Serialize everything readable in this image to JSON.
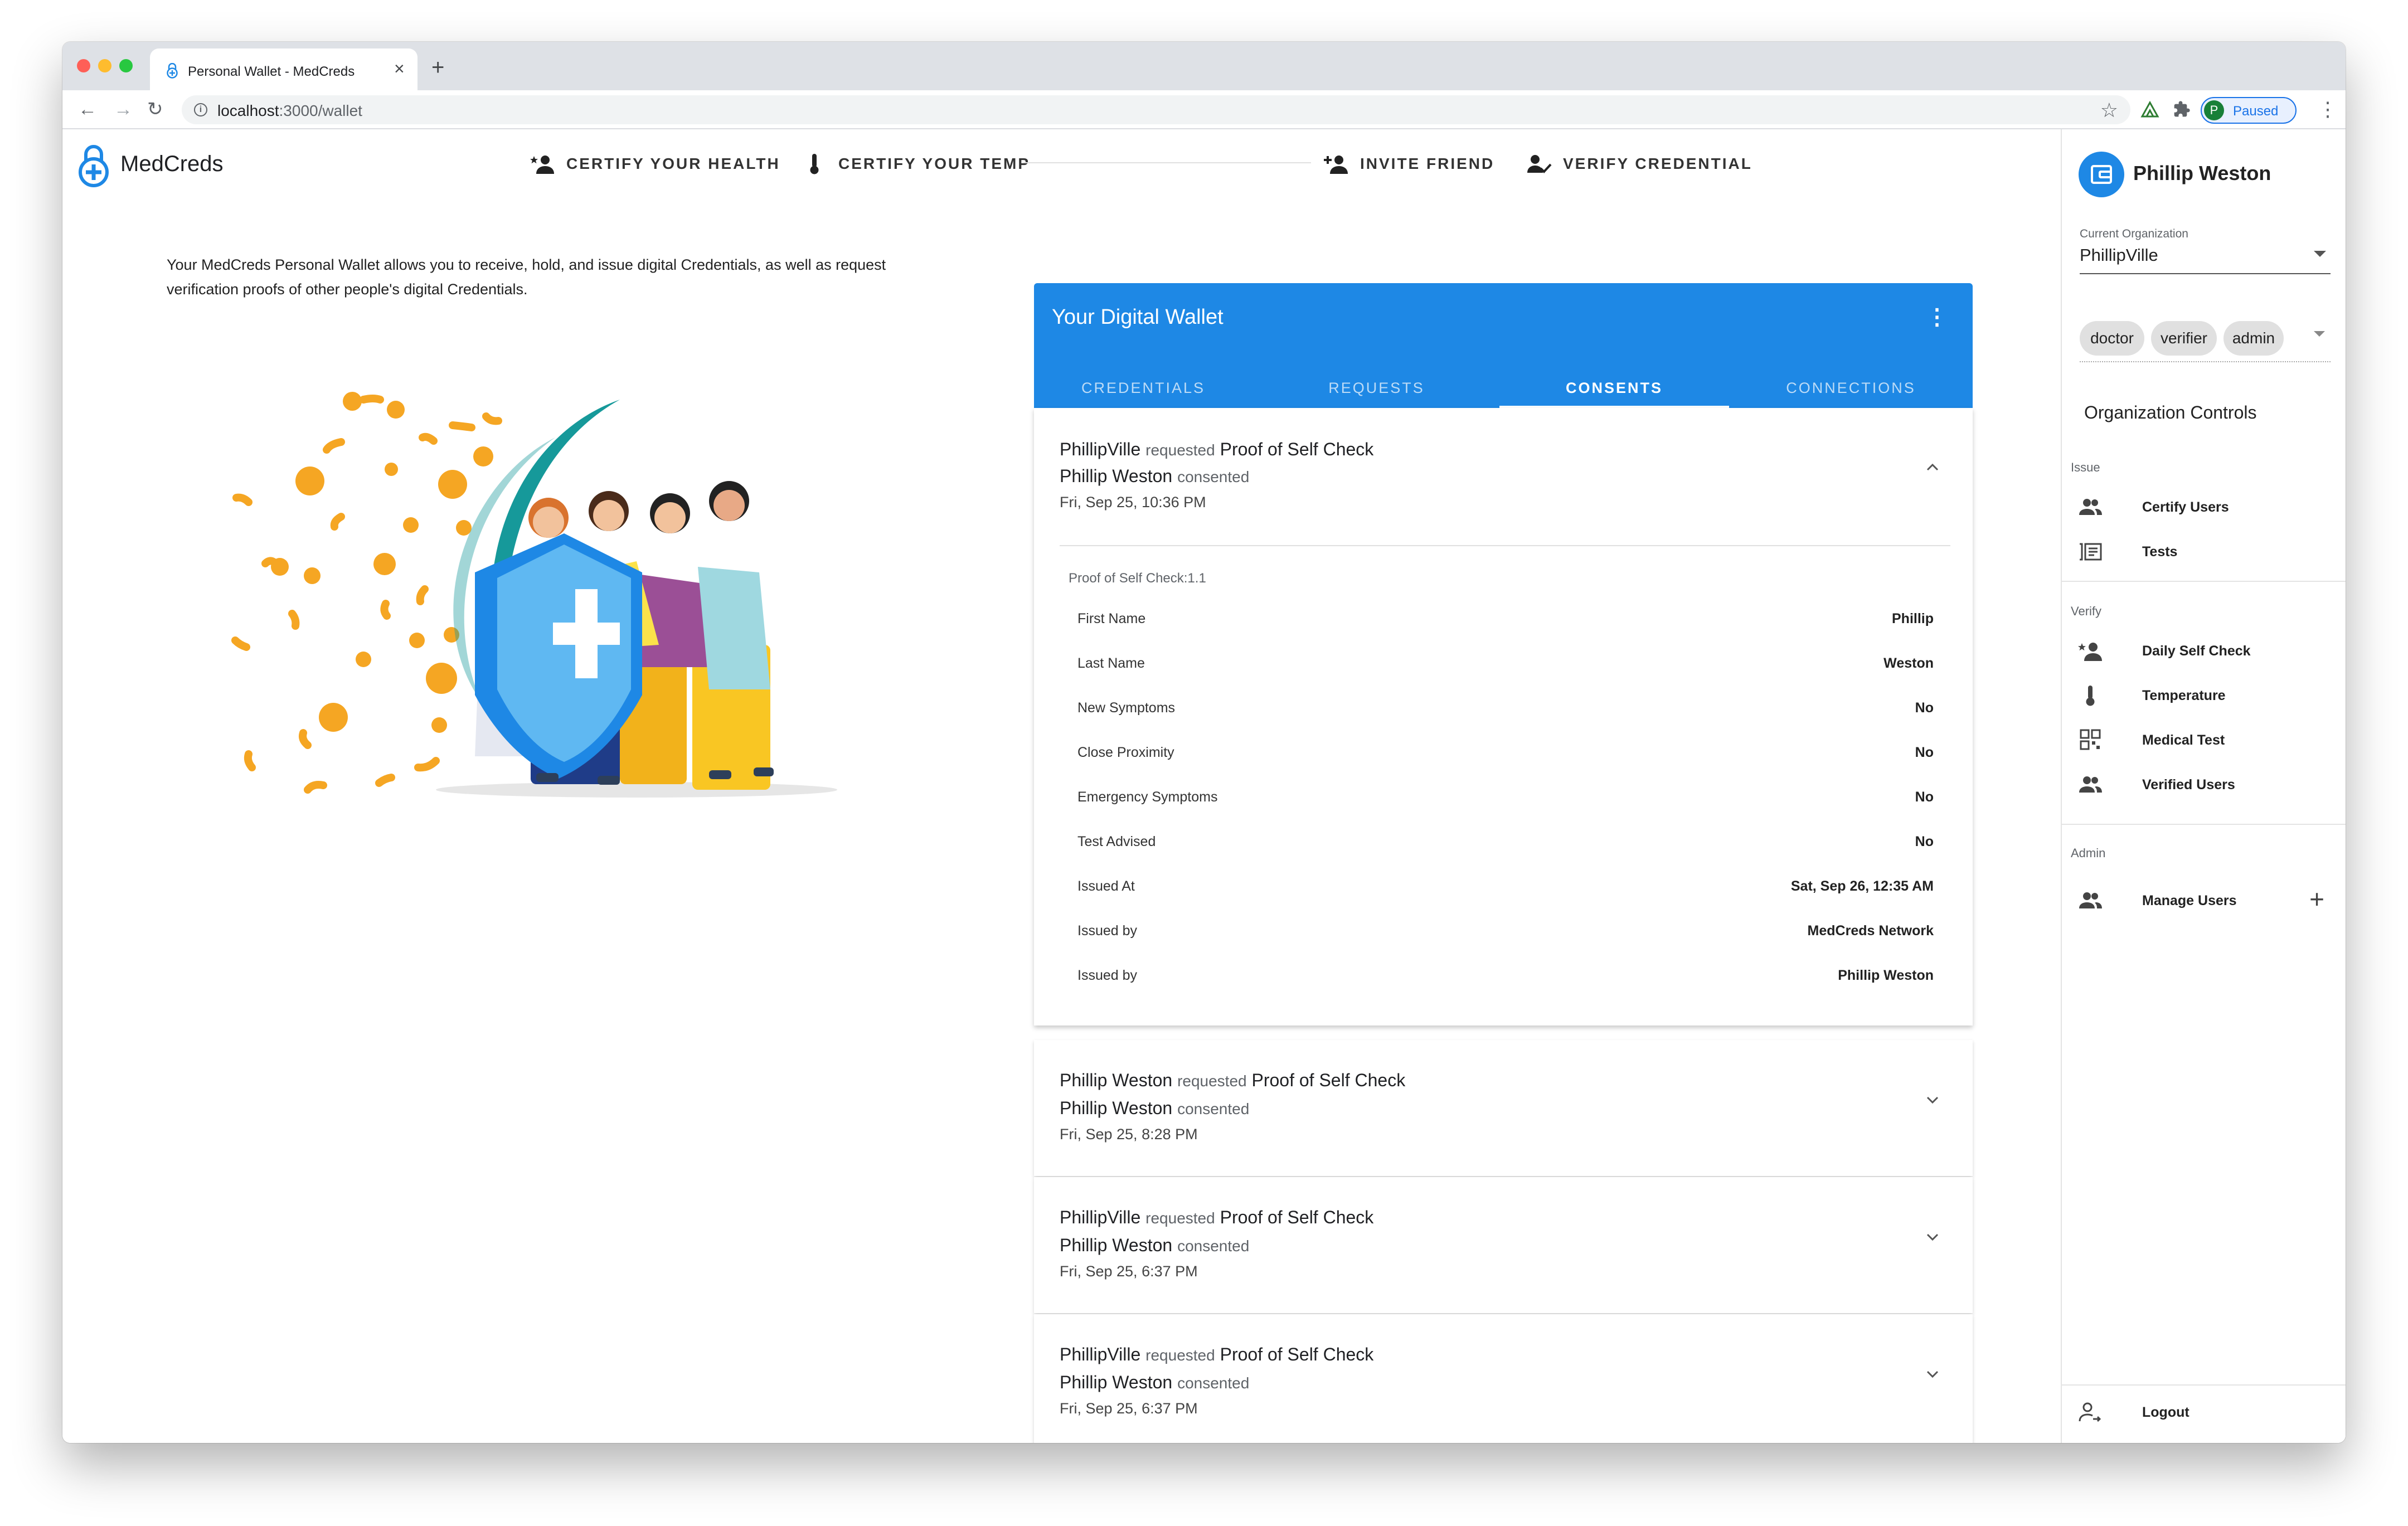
{
  "browser": {
    "tab_title": "Personal Wallet - MedCreds",
    "url_host": "localhost",
    "url_path": ":3000/wallet",
    "profile_initial": "P",
    "profile_status": "Paused"
  },
  "app": {
    "brand": "MedCreds",
    "nav": {
      "certify_health": "CERTIFY YOUR HEALTH",
      "certify_temp": "CERTIFY YOUR TEMP",
      "invite_friend": "INVITE FRIEND",
      "verify_credential": "VERIFY CREDENTIAL"
    },
    "intro": "Your MedCreds Personal Wallet allows you to receive, hold, and issue digital Credentials, as well as request verification proofs of other people's digital Credentials."
  },
  "wallet": {
    "title": "Your Digital Wallet",
    "tabs": [
      "CREDENTIALS",
      "REQUESTS",
      "CONSENTS",
      "CONNECTIONS"
    ],
    "active_tab": "CONSENTS",
    "expanded": {
      "requester": "PhillipVille",
      "requested_word": "requested",
      "proof": "Proof of Self Check",
      "consenter": "Phillip Weston",
      "consented_word": "consented",
      "date": "Fri, Sep 25, 10:36 PM",
      "proof_label": "Proof of Self Check:1.1",
      "fields": [
        {
          "label": "First Name",
          "value": "Phillip"
        },
        {
          "label": "Last Name",
          "value": "Weston"
        },
        {
          "label": "New Symptoms",
          "value": "No"
        },
        {
          "label": "Close Proximity",
          "value": "No"
        },
        {
          "label": "Emergency Symptoms",
          "value": "No"
        },
        {
          "label": "Test Advised",
          "value": "No"
        },
        {
          "label": "Issued At",
          "value": "Sat, Sep 26, 12:35 AM"
        },
        {
          "label": "Issued by",
          "value": "MedCreds Network"
        },
        {
          "label": "Issued by",
          "value": "Phillip Weston"
        }
      ]
    },
    "collapsed": [
      {
        "requester": "Phillip Weston",
        "requested_word": "requested",
        "proof": "Proof of Self Check",
        "consenter": "Phillip Weston",
        "consented_word": "consented",
        "date": "Fri, Sep 25, 8:28 PM"
      },
      {
        "requester": "PhillipVille",
        "requested_word": "requested",
        "proof": "Proof of Self Check",
        "consenter": "Phillip Weston",
        "consented_word": "consented",
        "date": "Fri, Sep 25, 6:37 PM"
      },
      {
        "requester": "PhillipVille",
        "requested_word": "requested",
        "proof": "Proof of Self Check",
        "consenter": "Phillip Weston",
        "consented_word": "consented",
        "date": "Fri, Sep 25, 6:37 PM"
      }
    ]
  },
  "sidebar": {
    "user_name": "Phillip Weston",
    "org_label": "Current Organization",
    "org_value": "PhillipVille",
    "roles": [
      "doctor",
      "verifier",
      "admin"
    ],
    "controls_title": "Organization Controls",
    "issue_section": "Issue",
    "issue_items": [
      "Certify Users",
      "Tests"
    ],
    "verify_section": "Verify",
    "verify_items": [
      "Daily Self Check",
      "Temperature",
      "Medical Test",
      "Verified Users"
    ],
    "admin_section": "Admin",
    "admin_items": [
      "Manage Users"
    ],
    "logout": "Logout"
  },
  "colors": {
    "primary": "#1e88e5",
    "virus": "#f5a623",
    "shield": "#1e88e5",
    "arc": "#16999a"
  }
}
